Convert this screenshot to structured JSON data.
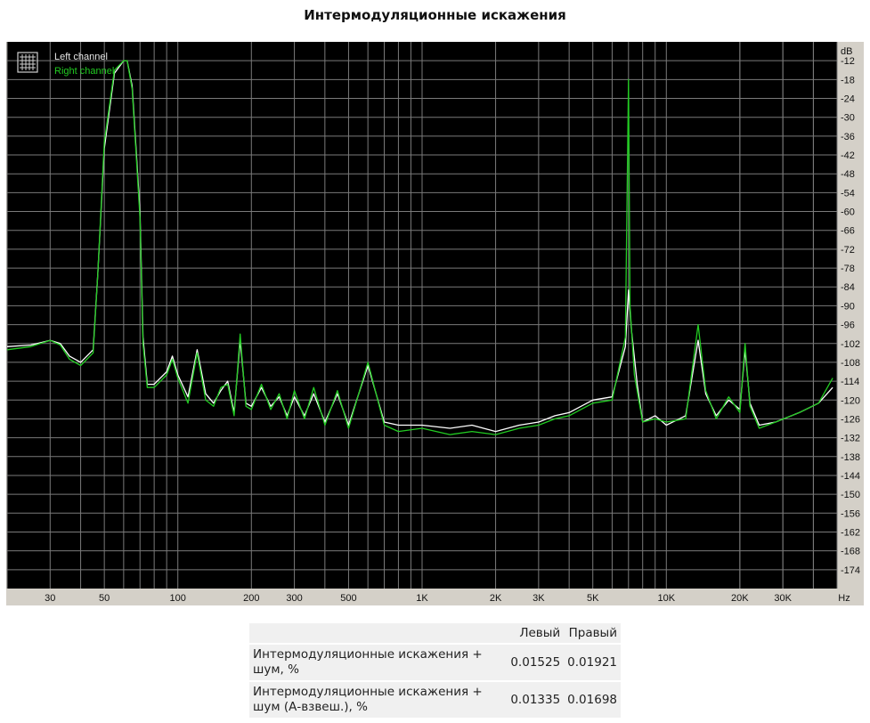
{
  "title": "Интермодуляционные искажения",
  "chart_data": {
    "type": "line",
    "xscale": "log",
    "xlim": [
      20,
      50000
    ],
    "ylim": [
      -180,
      -6
    ],
    "xunit": "Hz",
    "yunit": "dB",
    "x_ticks": [
      {
        "v": 30,
        "label": "30"
      },
      {
        "v": 50,
        "label": "50"
      },
      {
        "v": 100,
        "label": "100"
      },
      {
        "v": 200,
        "label": "200"
      },
      {
        "v": 300,
        "label": "300"
      },
      {
        "v": 500,
        "label": "500"
      },
      {
        "v": 1000,
        "label": "1K"
      },
      {
        "v": 2000,
        "label": "2K"
      },
      {
        "v": 3000,
        "label": "3K"
      },
      {
        "v": 5000,
        "label": "5K"
      },
      {
        "v": 10000,
        "label": "10K"
      },
      {
        "v": 20000,
        "label": "20K"
      },
      {
        "v": 30000,
        "label": "30K"
      }
    ],
    "y_ticks": [
      -12,
      -18,
      -24,
      -30,
      -36,
      -42,
      -48,
      -54,
      -60,
      -66,
      -72,
      -78,
      -84,
      -90,
      -96,
      -102,
      -108,
      -114,
      -120,
      -126,
      -132,
      -138,
      -144,
      -150,
      -156,
      -162,
      -168,
      -174
    ],
    "grid": true,
    "legend": {
      "position": "top-left"
    },
    "series": [
      {
        "name": "Left channel",
        "color": "#ffffff",
        "points": [
          [
            20,
            -103
          ],
          [
            25,
            -102.5
          ],
          [
            30,
            -101
          ],
          [
            33,
            -102
          ],
          [
            36,
            -106
          ],
          [
            40,
            -108
          ],
          [
            45,
            -104
          ],
          [
            47,
            -80
          ],
          [
            50,
            -40
          ],
          [
            55,
            -16
          ],
          [
            60,
            -12
          ],
          [
            62,
            -12
          ],
          [
            65,
            -20
          ],
          [
            70,
            -60
          ],
          [
            72,
            -100
          ],
          [
            75,
            -115
          ],
          [
            80,
            -115
          ],
          [
            90,
            -111
          ],
          [
            95,
            -106
          ],
          [
            100,
            -112
          ],
          [
            110,
            -119
          ],
          [
            120,
            -104
          ],
          [
            130,
            -118
          ],
          [
            140,
            -121
          ],
          [
            150,
            -117
          ],
          [
            160,
            -114
          ],
          [
            170,
            -124
          ],
          [
            180,
            -101
          ],
          [
            190,
            -121
          ],
          [
            200,
            -122
          ],
          [
            220,
            -116
          ],
          [
            240,
            -122
          ],
          [
            260,
            -119
          ],
          [
            280,
            -125
          ],
          [
            300,
            -119
          ],
          [
            330,
            -125
          ],
          [
            360,
            -118
          ],
          [
            400,
            -127
          ],
          [
            450,
            -118
          ],
          [
            500,
            -128
          ],
          [
            600,
            -109
          ],
          [
            700,
            -127
          ],
          [
            800,
            -128
          ],
          [
            1000,
            -128
          ],
          [
            1300,
            -129
          ],
          [
            1600,
            -128
          ],
          [
            2000,
            -130
          ],
          [
            2500,
            -128
          ],
          [
            3000,
            -127
          ],
          [
            3500,
            -125
          ],
          [
            4000,
            -124
          ],
          [
            5000,
            -120
          ],
          [
            6000,
            -119
          ],
          [
            6800,
            -103
          ],
          [
            7000,
            -85
          ],
          [
            7200,
            -98
          ],
          [
            7600,
            -115
          ],
          [
            8000,
            -127
          ],
          [
            9000,
            -125
          ],
          [
            10000,
            -128
          ],
          [
            12000,
            -125
          ],
          [
            13500,
            -101
          ],
          [
            14500,
            -118
          ],
          [
            16000,
            -125
          ],
          [
            18000,
            -120
          ],
          [
            20000,
            -123
          ],
          [
            21000,
            -104
          ],
          [
            22000,
            -121
          ],
          [
            24000,
            -128
          ],
          [
            28000,
            -127
          ],
          [
            35000,
            -124
          ],
          [
            42000,
            -121
          ],
          [
            48000,
            -116
          ]
        ]
      },
      {
        "name": "Right channel",
        "color": "#22cc22",
        "points": [
          [
            20,
            -104
          ],
          [
            25,
            -103
          ],
          [
            30,
            -101
          ],
          [
            33,
            -102.5
          ],
          [
            36,
            -107
          ],
          [
            40,
            -109
          ],
          [
            45,
            -105
          ],
          [
            47,
            -80
          ],
          [
            50,
            -38
          ],
          [
            55,
            -15
          ],
          [
            60,
            -12
          ],
          [
            62,
            -12
          ],
          [
            65,
            -21
          ],
          [
            70,
            -62
          ],
          [
            72,
            -102
          ],
          [
            75,
            -116
          ],
          [
            80,
            -116
          ],
          [
            90,
            -112
          ],
          [
            95,
            -107
          ],
          [
            100,
            -113
          ],
          [
            110,
            -121
          ],
          [
            120,
            -105
          ],
          [
            130,
            -120
          ],
          [
            140,
            -122
          ],
          [
            150,
            -116
          ],
          [
            160,
            -115
          ],
          [
            170,
            -125
          ],
          [
            180,
            -99
          ],
          [
            190,
            -122
          ],
          [
            200,
            -123
          ],
          [
            220,
            -115
          ],
          [
            240,
            -123
          ],
          [
            260,
            -118
          ],
          [
            280,
            -126
          ],
          [
            300,
            -117
          ],
          [
            330,
            -126
          ],
          [
            360,
            -116
          ],
          [
            400,
            -128
          ],
          [
            450,
            -117
          ],
          [
            500,
            -129
          ],
          [
            600,
            -108
          ],
          [
            700,
            -128
          ],
          [
            800,
            -130
          ],
          [
            1000,
            -129
          ],
          [
            1300,
            -131
          ],
          [
            1600,
            -130
          ],
          [
            2000,
            -131
          ],
          [
            2500,
            -129
          ],
          [
            3000,
            -128
          ],
          [
            3500,
            -126
          ],
          [
            4000,
            -125
          ],
          [
            5000,
            -121
          ],
          [
            6000,
            -120
          ],
          [
            6800,
            -100
          ],
          [
            7000,
            -18
          ],
          [
            7100,
            -90
          ],
          [
            7400,
            -112
          ],
          [
            8000,
            -127
          ],
          [
            9000,
            -126
          ],
          [
            10000,
            -127
          ],
          [
            12000,
            -126
          ],
          [
            13500,
            -96
          ],
          [
            14500,
            -117
          ],
          [
            16000,
            -126
          ],
          [
            18000,
            -119
          ],
          [
            20000,
            -124
          ],
          [
            21000,
            -102
          ],
          [
            22000,
            -122
          ],
          [
            24000,
            -129
          ],
          [
            28000,
            -127
          ],
          [
            35000,
            -124
          ],
          [
            42000,
            -121
          ],
          [
            48000,
            -113
          ]
        ]
      }
    ]
  },
  "results_table": {
    "headers": [
      "",
      "Левый",
      "Правый"
    ],
    "rows": [
      {
        "label": "Интермодуляционные искажения + шум, %",
        "left": "0.01525",
        "right": "0.01921"
      },
      {
        "label": "Интермодуляционные искажения + шум (А-взвеш.), %",
        "left": "0.01335",
        "right": "0.01698"
      }
    ]
  }
}
